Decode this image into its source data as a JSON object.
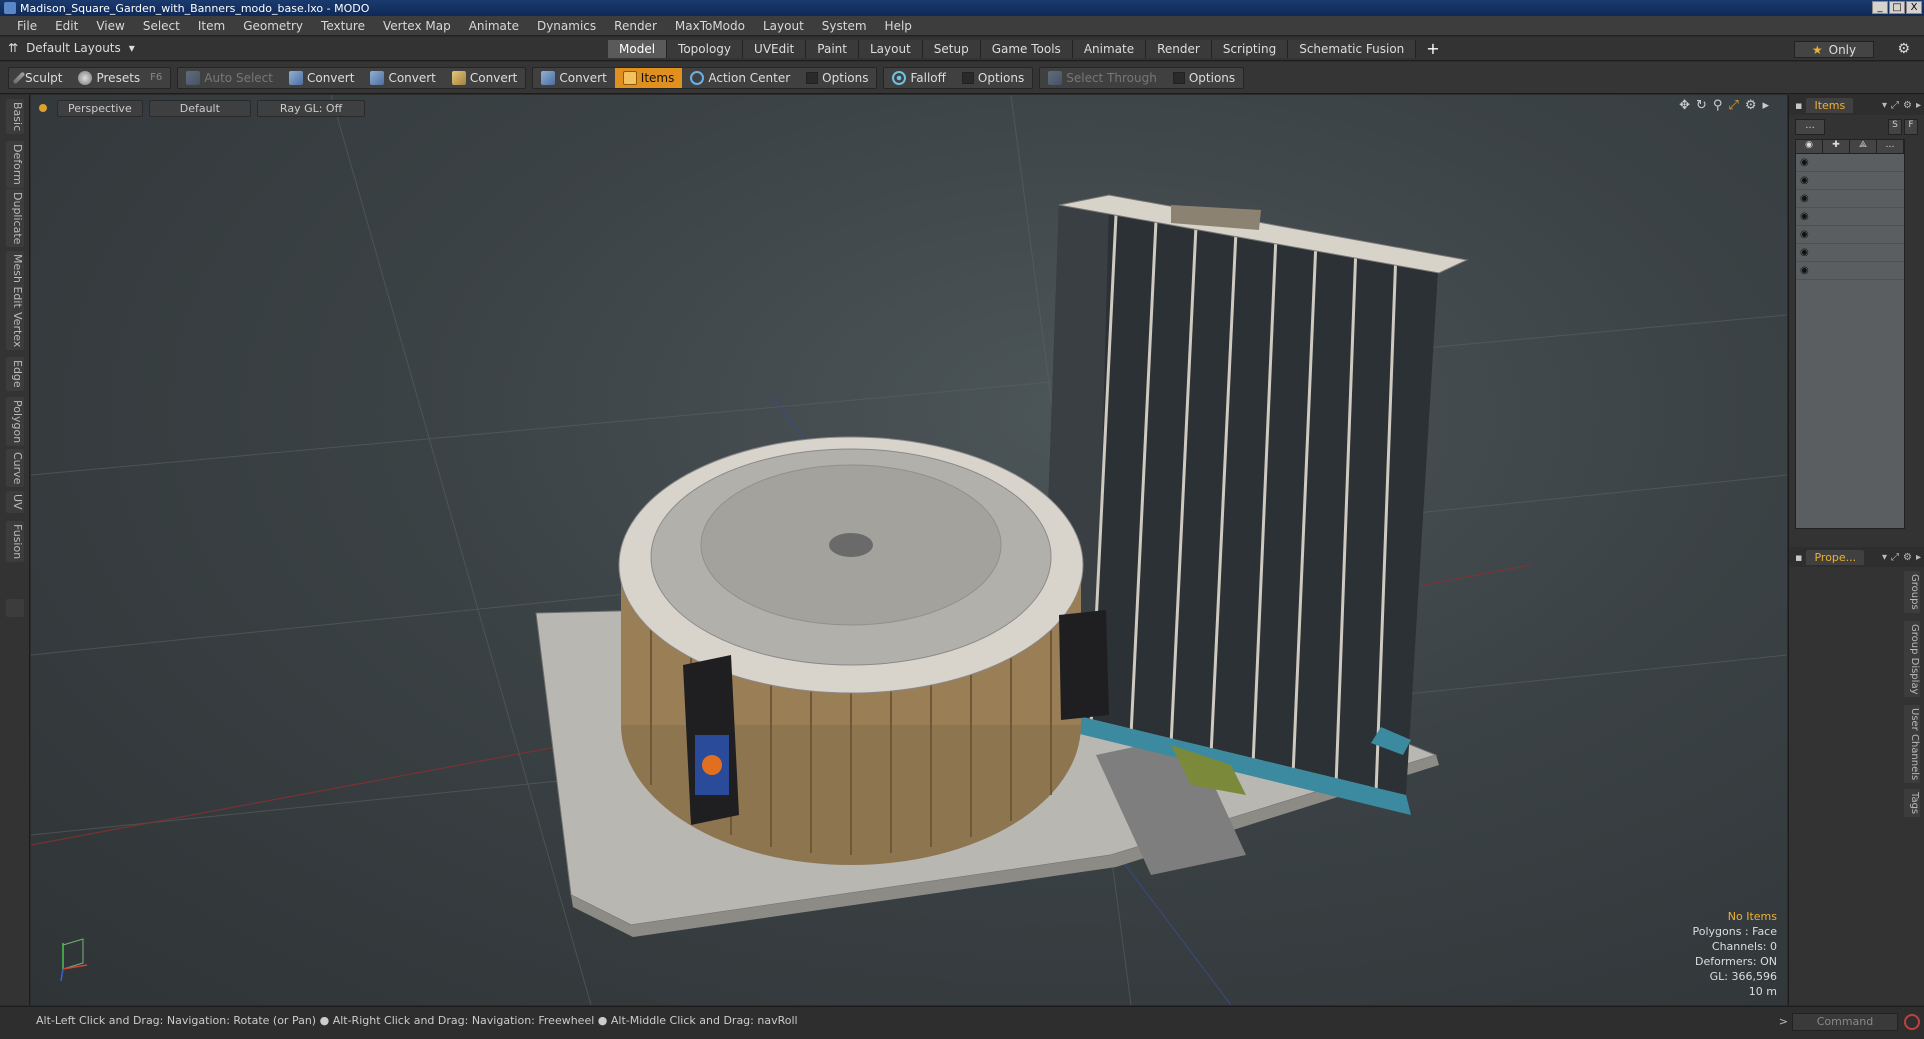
{
  "window": {
    "title": "Madison_Square_Garden_with_Banners_modo_base.lxo - MODO",
    "buttons": [
      "_",
      "□",
      "X"
    ]
  },
  "menu": [
    "File",
    "Edit",
    "View",
    "Select",
    "Item",
    "Geometry",
    "Texture",
    "Vertex Map",
    "Animate",
    "Dynamics",
    "Render",
    "MaxToModo",
    "Layout",
    "System",
    "Help"
  ],
  "layouts": {
    "label": "Default Layouts",
    "tabs": [
      "Model",
      "Topology",
      "UVEdit",
      "Paint",
      "Layout",
      "Setup",
      "Game Tools",
      "Animate",
      "Render",
      "Scripting",
      "Schematic Fusion"
    ],
    "active_tab": "Model",
    "only_label": "Only"
  },
  "toolbar": {
    "sculpt": "Sculpt",
    "presets": "Presets",
    "presets_key": "F6",
    "auto_select": "Auto Select",
    "convert1": "Convert",
    "convert2": "Convert",
    "convert3": "Convert",
    "convert4": "Convert",
    "items": "Items",
    "action_center": "Action Center",
    "options1": "Options",
    "falloff": "Falloff",
    "options2": "Options",
    "select_through": "Select Through",
    "options3": "Options"
  },
  "left_tabs": [
    "Basic",
    "Deform",
    "Duplicate",
    "Mesh Edit",
    "Vertex",
    "Edge",
    "Polygon",
    "Curve",
    "UV",
    "Fusion"
  ],
  "viewport": {
    "view": "Perspective",
    "shading": "Default",
    "raygl": "Ray GL: Off",
    "info": {
      "selection": "No Items",
      "polygons": "Polygons : Face",
      "channels": "Channels: 0",
      "deformers": "Deformers: ON",
      "gl": "GL: 366,596",
      "scale": "10 m"
    }
  },
  "status": {
    "hint": "Alt-Left Click and Drag: Navigation: Rotate (or Pan) ● Alt-Right Click and Drag: Navigation: Freewheel ● Alt-Middle Click and Drag: navRoll",
    "command_placeholder": "Command"
  },
  "right_panel": {
    "items_tab": "Items",
    "filter": "...",
    "s": "S",
    "f": "F",
    "props_tab": "Prope...",
    "props_vtabs": [
      "Groups",
      "Group Display",
      "User Channels",
      "Tags"
    ]
  },
  "colors": {
    "accent": "#f0b030",
    "active_tool": "#e0901e"
  }
}
